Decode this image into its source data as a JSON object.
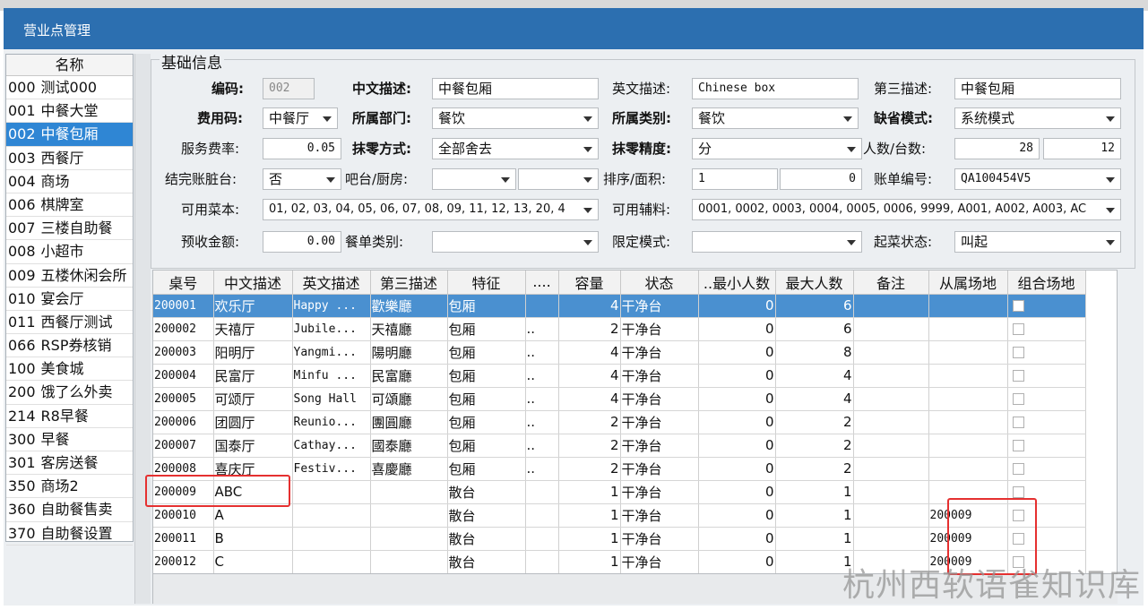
{
  "window": {
    "title": "营业点管理"
  },
  "left_list": {
    "header": "名称",
    "items": [
      {
        "code": "000",
        "name": "测试000",
        "selected": false
      },
      {
        "code": "001",
        "name": "中餐大堂",
        "selected": false
      },
      {
        "code": "002",
        "name": "中餐包厢",
        "selected": true
      },
      {
        "code": "003",
        "name": "西餐厅",
        "selected": false
      },
      {
        "code": "004",
        "name": "商场",
        "selected": false
      },
      {
        "code": "006",
        "name": "棋牌室",
        "selected": false
      },
      {
        "code": "007",
        "name": "三楼自助餐",
        "selected": false
      },
      {
        "code": "008",
        "name": "小超市",
        "selected": false
      },
      {
        "code": "009",
        "name": "五楼休闲会所",
        "selected": false
      },
      {
        "code": "010",
        "name": "宴会厅",
        "selected": false
      },
      {
        "code": "011",
        "name": "西餐厅测试",
        "selected": false
      },
      {
        "code": "066",
        "name": "RSP券核销",
        "selected": false
      },
      {
        "code": "100",
        "name": "美食城",
        "selected": false
      },
      {
        "code": "200",
        "name": "饿了么外卖",
        "selected": false
      },
      {
        "code": "214",
        "name": "R8早餐",
        "selected": false
      },
      {
        "code": "300",
        "name": "早餐",
        "selected": false
      },
      {
        "code": "301",
        "name": "客房送餐",
        "selected": false
      },
      {
        "code": "350",
        "name": "商场2",
        "selected": false
      },
      {
        "code": "360",
        "name": "自助餐售卖",
        "selected": false
      },
      {
        "code": "370",
        "name": "自助餐设置",
        "selected": false
      }
    ]
  },
  "basic_info": {
    "legend": "基础信息",
    "code_label": "编码:",
    "code_value": "002",
    "cn_desc_label": "中文描述:",
    "cn_desc_value": "中餐包厢",
    "en_desc_label": "英文描述:",
    "en_desc_value": "Chinese box",
    "third_desc_label": "第三描述:",
    "third_desc_value": "中餐包厢",
    "fee_code_label": "费用码:",
    "fee_code_value": "中餐厅",
    "dept_label": "所属部门:",
    "dept_value": "餐饮",
    "category_label": "所属类别:",
    "category_value": "餐饮",
    "default_mode_label": "缺省模式:",
    "default_mode_value": "系统模式",
    "service_rate_label": "服务费率:",
    "service_rate_value": "0.05",
    "rounding_method_label": "抹零方式:",
    "rounding_method_value": "全部舍去",
    "rounding_precision_label": "抹零精度:",
    "rounding_precision_value": "分",
    "people_label": "人数/台数:",
    "people_value": "28",
    "tables_value": "12",
    "dirty_label": "结完账脏台:",
    "dirty_value": "否",
    "bar_label": "吧台/厨房:",
    "bar_value": "",
    "kitchen_value": "",
    "sort_label": "排序/面积:",
    "sort_value": "1",
    "area_value": "0",
    "bill_no_label": "账单编号:",
    "bill_no_value": "QA100454V5",
    "menus_label": "可用菜本:",
    "menus_value": "01, 02, 03, 04, 05, 06, 07, 08, 09, 11, 12, 13, 20, 4",
    "aux_label": "可用辅料:",
    "aux_value": "0001, 0002, 0003, 0004, 0005, 0006, 9999, A001, A002, A003, AC",
    "prepay_label": "预收金额:",
    "prepay_value": "0.00",
    "order_type_label": "餐单类别:",
    "order_type_value": "",
    "limit_mode_label": "限定模式:",
    "limit_mode_value": "",
    "serve_state_label": "起菜状态:",
    "serve_state_value": "叫起"
  },
  "table_grid": {
    "columns": [
      "桌号",
      "中文描述",
      "英文描述",
      "第三描述",
      "特征",
      "....",
      "容量",
      "状态",
      "..最小人数",
      "最大人数",
      "备注",
      "从属场地",
      "组合场地"
    ],
    "rows": [
      {
        "no": "200001",
        "cn": "欢乐厅",
        "en": "Happy ...",
        "third": "歡樂廳",
        "feature": "包厢",
        "dots": "",
        "cap": "4",
        "status": "干净台",
        "min": "0",
        "max": "6",
        "note": "",
        "parent": "",
        "selected": true
      },
      {
        "no": "200002",
        "cn": "天禧厅",
        "en": "Jubile...",
        "third": "天禧廳",
        "feature": "包厢",
        "dots": "..",
        "cap": "2",
        "status": "干净台",
        "min": "0",
        "max": "6",
        "note": "",
        "parent": "",
        "selected": false
      },
      {
        "no": "200003",
        "cn": "阳明厅",
        "en": "Yangmi...",
        "third": "陽明廳",
        "feature": "包厢",
        "dots": "..",
        "cap": "4",
        "status": "干净台",
        "min": "0",
        "max": "8",
        "note": "",
        "parent": "",
        "selected": false
      },
      {
        "no": "200004",
        "cn": "民富厅",
        "en": "Minfu ...",
        "third": "民富廳",
        "feature": "包厢",
        "dots": "..",
        "cap": "4",
        "status": "干净台",
        "min": "0",
        "max": "4",
        "note": "",
        "parent": "",
        "selected": false
      },
      {
        "no": "200005",
        "cn": "可颂厅",
        "en": "Song Hall",
        "third": "可頌廳",
        "feature": "包厢",
        "dots": "..",
        "cap": "4",
        "status": "干净台",
        "min": "0",
        "max": "4",
        "note": "",
        "parent": "",
        "selected": false
      },
      {
        "no": "200006",
        "cn": "团圆厅",
        "en": "Reunio...",
        "third": "團圓廳",
        "feature": "包厢",
        "dots": "..",
        "cap": "2",
        "status": "干净台",
        "min": "0",
        "max": "2",
        "note": "",
        "parent": "",
        "selected": false
      },
      {
        "no": "200007",
        "cn": "国泰厅",
        "en": "Cathay...",
        "third": "國泰廳",
        "feature": "包厢",
        "dots": "..",
        "cap": "2",
        "status": "干净台",
        "min": "0",
        "max": "2",
        "note": "",
        "parent": "",
        "selected": false
      },
      {
        "no": "200008",
        "cn": "喜庆厅",
        "en": "Festiv...",
        "third": "喜慶廳",
        "feature": "包厢",
        "dots": "..",
        "cap": "2",
        "status": "干净台",
        "min": "0",
        "max": "2",
        "note": "",
        "parent": "",
        "selected": false
      },
      {
        "no": "200009",
        "cn": "ABC",
        "en": "",
        "third": "",
        "feature": "散台",
        "dots": "",
        "cap": "1",
        "status": "干净台",
        "min": "0",
        "max": "1",
        "note": "",
        "parent": "",
        "selected": false
      },
      {
        "no": "200010",
        "cn": "A",
        "en": "",
        "third": "",
        "feature": "散台",
        "dots": "",
        "cap": "1",
        "status": "干净台",
        "min": "0",
        "max": "1",
        "note": "",
        "parent": "200009",
        "selected": false
      },
      {
        "no": "200011",
        "cn": "B",
        "en": "",
        "third": "",
        "feature": "散台",
        "dots": "",
        "cap": "1",
        "status": "干净台",
        "min": "0",
        "max": "1",
        "note": "",
        "parent": "200009",
        "selected": false
      },
      {
        "no": "200012",
        "cn": "C",
        "en": "",
        "third": "",
        "feature": "散台",
        "dots": "",
        "cap": "1",
        "status": "干净台",
        "min": "0",
        "max": "1",
        "note": "",
        "parent": "200009",
        "selected": false
      }
    ]
  },
  "watermark": "杭州西软语雀知识库",
  "colors": {
    "titlebar": "#2c6fb0",
    "selection": "#2f86d4",
    "highlight_box": "#e53030"
  }
}
